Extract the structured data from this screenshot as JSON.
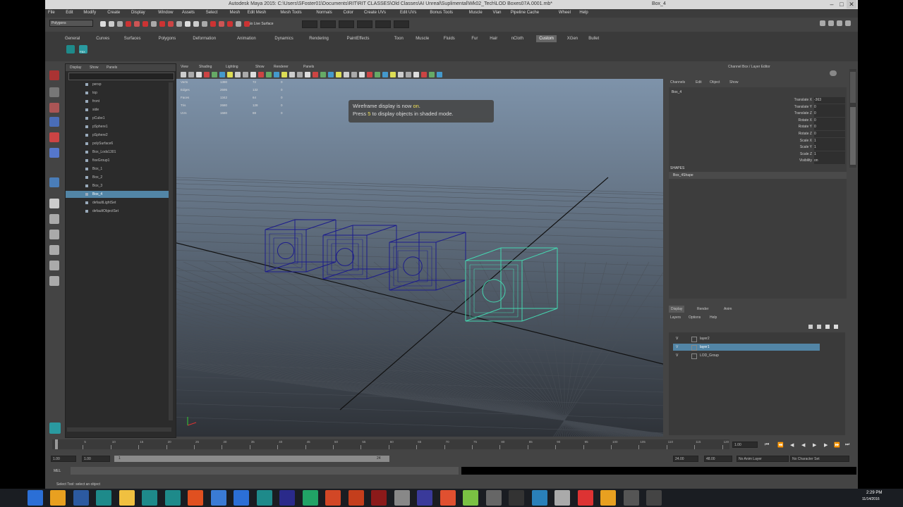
{
  "window": {
    "title": "Autodesk Maya 2015: C:\\Users\\SFoster01\\Documents\\RIT\\RIT CLASSES\\Old Classes\\AI Unreal\\Suplimental\\Wk02_Tech\\LOD Boxes07A.0001.mb*",
    "object_field": "Box_4",
    "buttons": {
      "minimize": "–",
      "maximize": "□",
      "close": "✕"
    }
  },
  "menubar": [
    "File",
    "Edit",
    "Modify",
    "Create",
    "Display",
    "Window",
    "Assets",
    "Select",
    "Mesh",
    "Edit Mesh",
    "Mesh Tools",
    "Normals",
    "Color",
    "Create UVs",
    "Edit UVs",
    "Bonus Tools",
    "Muscle",
    "Vlan",
    "Pipeline Cache",
    "Wheel",
    "Help"
  ],
  "statusline": {
    "mode": "Polygons",
    "surface": "No Live Surface"
  },
  "shelf": {
    "tabs": [
      "General",
      "Curves",
      "Surfaces",
      "Polygons",
      "Deformation",
      "Animation",
      "Dynamics",
      "Rendering",
      "PaintEffects",
      "Toon",
      "Muscle",
      "Fluids",
      "Fur",
      "Hair",
      "nCloth",
      "Custom",
      "XGen",
      "Bullet"
    ],
    "active_tab": "Custom",
    "button_label": "FBX"
  },
  "outliner": {
    "menu": [
      "Display",
      "Show",
      "Panels"
    ],
    "items": [
      "persp",
      "top",
      "front",
      "side",
      "pCube1",
      "pSphere1",
      "pSphere2",
      "polySurface6",
      "Box_Lods1301",
      "fixeGroup1",
      "Box_1",
      "Box_2",
      "Box_3",
      "Box_4",
      "defaultLightSet",
      "defaultObjectSet"
    ],
    "selected_index": 13
  },
  "viewport": {
    "menu": [
      "View",
      "Shading",
      "Lighting",
      "Show",
      "Renderer",
      "Panels"
    ],
    "hud_stats": [
      {
        "label": "Verts",
        "a": "1390",
        "b": "72",
        "c": "0"
      },
      {
        "label": "Edges",
        "a": "2695",
        "b": "132",
        "c": "0"
      },
      {
        "label": "Faces",
        "a": "1342",
        "b": "64",
        "c": "0"
      },
      {
        "label": "Tris",
        "a": "2680",
        "b": "128",
        "c": "0"
      },
      {
        "label": "UVs",
        "a": "1680",
        "b": "88",
        "c": "0"
      }
    ],
    "message_line1_pre": "Wireframe display is now ",
    "message_line1_hl": "on",
    "message_line1_post": ".",
    "message_line2_pre": "Press ",
    "message_line2_hl": "5",
    "message_line2_post": " to display objects in shaded mode."
  },
  "channelbox": {
    "header": "Channel Box / Layer Editor",
    "menu": [
      "Channels",
      "Edit",
      "Object",
      "Show"
    ],
    "object": "Box_4",
    "attributes": [
      {
        "name": "Translate X",
        "value": "-363"
      },
      {
        "name": "Translate Y",
        "value": "0"
      },
      {
        "name": "Translate Z",
        "value": "0"
      },
      {
        "name": "Rotate X",
        "value": "0"
      },
      {
        "name": "Rotate Y",
        "value": "0"
      },
      {
        "name": "Rotate Z",
        "value": "0"
      },
      {
        "name": "Scale X",
        "value": "1"
      },
      {
        "name": "Scale Y",
        "value": "1"
      },
      {
        "name": "Scale Z",
        "value": "1"
      },
      {
        "name": "Visibility",
        "value": "on"
      }
    ],
    "shapes_label": "SHAPES",
    "shape": "Box_4Shape",
    "side_tabs": [
      "Attribute Editor",
      "Channel Box / Layer Editor"
    ]
  },
  "layers": {
    "tabs": [
      "Display",
      "Render",
      "Anim"
    ],
    "menu": [
      "Layers",
      "Options",
      "Help"
    ],
    "rows": [
      {
        "v": "V",
        "name": "layer2",
        "selected": false
      },
      {
        "v": "V",
        "name": "layer1",
        "selected": true
      },
      {
        "v": "V",
        "name": "LOD_Group",
        "selected": false
      }
    ]
  },
  "timeline": {
    "ticks": [
      "1",
      "5",
      "10",
      "15",
      "20",
      "25",
      "30",
      "35",
      "40",
      "45",
      "50",
      "55",
      "60",
      "65",
      "70",
      "75",
      "80",
      "85",
      "90",
      "95",
      "100",
      "105",
      "110",
      "115",
      "120"
    ],
    "current": "1.00"
  },
  "range": {
    "start": "1.00",
    "start2": "1.00",
    "mid": "1",
    "end_slider": "24",
    "end": "24.00",
    "end2": "48.00",
    "anim_layer": "No Anim Layer",
    "char_set": "No Character Set"
  },
  "cmdline": {
    "label": "MEL"
  },
  "helpline": {
    "text": "Select Tool: select an object"
  },
  "taskbar": {
    "time": "2:29 PM",
    "date": "11/14/2016"
  },
  "colors": {
    "selection": "#5285a6",
    "wireframe": "#1c1c8c",
    "selected_wire": "#45d6b0",
    "maya_bg": "#444444",
    "viewport_top": "#7e93aa",
    "viewport_bottom": "#2e3238"
  }
}
